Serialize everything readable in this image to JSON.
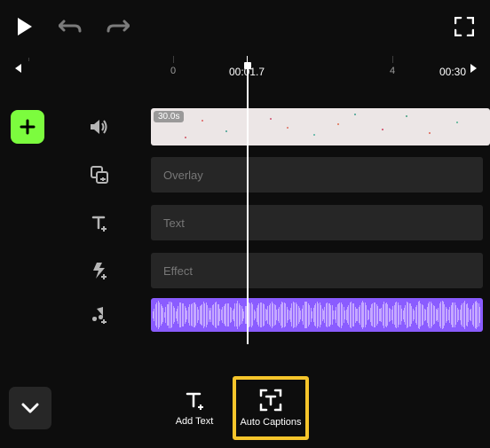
{
  "ruler": {
    "zero": "0",
    "current": "00:01.7",
    "mid": "4",
    "end": "00:30"
  },
  "video": {
    "duration": "30.0s"
  },
  "tracks": {
    "overlay": "Overlay",
    "text": "Text",
    "effect": "Effect"
  },
  "actions": {
    "addText": "Add Text",
    "autoCaptions": "Auto Captions"
  },
  "colors": {
    "accent": "#7cfc3e",
    "highlight": "#f6c52b",
    "audio": "#8a5cff"
  }
}
